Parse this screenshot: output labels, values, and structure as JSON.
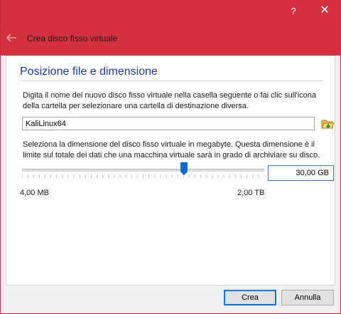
{
  "window": {
    "help_glyph": "?",
    "close_glyph": "✕"
  },
  "wizard": {
    "title": "Crea disco fisso virtuale"
  },
  "section": {
    "title": "Posizione file e dimensione",
    "location_description": "Digita il nome del nuovo disco fisso virtuale nella casella seguente o fai clic sull'icona della cartella per selezionare una cartella di destinazione diversa.",
    "size_description": "Seleziona la dimensione del disco fisso virtuale in megabyte. Questa dimensione è il limite sul totale dei dati che una macchina virtuale sarà in grado di archiviare su disco."
  },
  "file": {
    "name": "KaliLinux64"
  },
  "size": {
    "value": "30,00 GB",
    "min_label": "4,00 MB",
    "max_label": "2,00 TB",
    "slider_fraction": 0.67
  },
  "buttons": {
    "create": "Crea",
    "cancel": "Annulla"
  },
  "colors": {
    "titlebar": "#d3313f",
    "section_title": "#1e3c96",
    "focus_border": "#0078d7"
  }
}
